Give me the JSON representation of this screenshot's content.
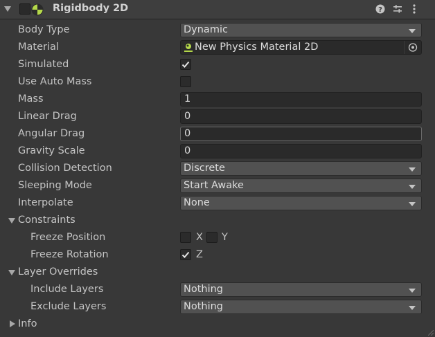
{
  "header": {
    "title": "Rigidbody 2D"
  },
  "fields": {
    "body_type": {
      "label": "Body Type",
      "value": "Dynamic"
    },
    "material": {
      "label": "Material",
      "value": "New Physics Material 2D"
    },
    "simulated": {
      "label": "Simulated",
      "checked": true
    },
    "use_auto_mass": {
      "label": "Use Auto Mass",
      "checked": false
    },
    "mass": {
      "label": "Mass",
      "value": "1"
    },
    "linear_drag": {
      "label": "Linear Drag",
      "value": "0"
    },
    "angular_drag": {
      "label": "Angular Drag",
      "value": "0"
    },
    "gravity_scale": {
      "label": "Gravity Scale",
      "value": "0"
    },
    "collision_detection": {
      "label": "Collision Detection",
      "value": "Discrete"
    },
    "sleeping_mode": {
      "label": "Sleeping Mode",
      "value": "Start Awake"
    },
    "interpolate": {
      "label": "Interpolate",
      "value": "None"
    }
  },
  "constraints": {
    "label": "Constraints",
    "freeze_position": {
      "label": "Freeze Position",
      "x_label": "X",
      "y_label": "Y",
      "x": false,
      "y": false
    },
    "freeze_rotation": {
      "label": "Freeze Rotation",
      "z_label": "Z",
      "z": true
    }
  },
  "layer_overrides": {
    "label": "Layer Overrides",
    "include_layers": {
      "label": "Include Layers",
      "value": "Nothing"
    },
    "exclude_layers": {
      "label": "Exclude Layers",
      "value": "Nothing"
    }
  },
  "info": {
    "label": "Info"
  },
  "colors": {
    "background": "#383838",
    "dropdown": "#515151",
    "field": "#2a2a2a",
    "text": "#c4c4c4"
  }
}
